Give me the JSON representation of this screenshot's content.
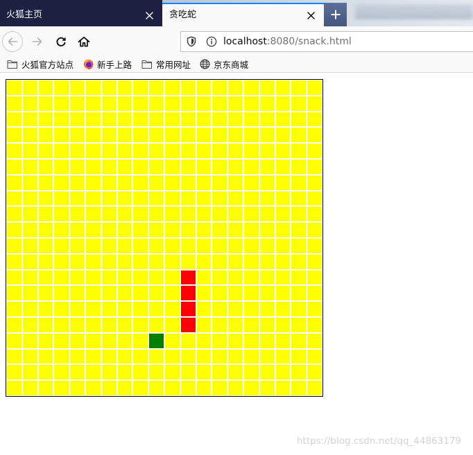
{
  "browser": {
    "tabs": [
      {
        "title": "火狐主页",
        "active": false,
        "close_icon": "close-icon"
      },
      {
        "title": "贪吃蛇",
        "active": true,
        "close_icon": "close-icon"
      }
    ],
    "new_tab_icon": "plus-icon",
    "navigation": {
      "icons": [
        "back-icon",
        "forward-icon",
        "reload-icon",
        "home-icon"
      ],
      "back_enabled": false,
      "forward_enabled": false
    },
    "url": {
      "host": "localhost",
      "path": ":8080/snack.html",
      "icons": [
        "shield-icon",
        "info-icon"
      ]
    },
    "bookmarks": [
      {
        "label": "火狐官方站点",
        "icon": "folder-icon"
      },
      {
        "label": "新手上路",
        "icon": "firefox-icon"
      },
      {
        "label": "常用网址",
        "icon": "folder-icon"
      },
      {
        "label": "京东商城",
        "icon": "globe-icon"
      }
    ],
    "colors": {
      "accent": "#0a84ff",
      "inactive_tab": "#1e2142",
      "toolbar": "#f9f9fa"
    }
  },
  "game": {
    "board": {
      "columns": 20,
      "rows": 20
    },
    "snake": [
      {
        "col": 11,
        "row": 12
      },
      {
        "col": 11,
        "row": 13
      },
      {
        "col": 11,
        "row": 14
      },
      {
        "col": 11,
        "row": 15
      }
    ],
    "food": {
      "col": 9,
      "row": 16
    },
    "colors": {
      "cell": "#ffff00",
      "grid_line": "#ffffff",
      "snake": "#ff0000",
      "food": "#008000",
      "border": "#000000"
    }
  },
  "watermark": "https://blog.csdn.net/qq_44863179"
}
